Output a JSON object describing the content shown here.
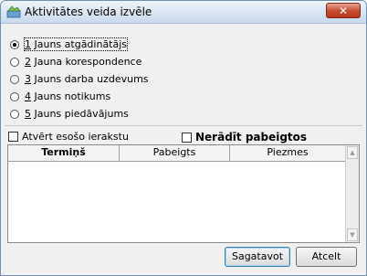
{
  "window": {
    "title": "Aktivitātes veida izvēle",
    "close_label": "✕"
  },
  "options": [
    {
      "number": "1",
      "label": " Jauns atgādinātājs",
      "checked": true
    },
    {
      "number": "2",
      "label": " Jauna korespondence",
      "checked": false
    },
    {
      "number": "3",
      "label": " Jauns darba uzdevums",
      "checked": false
    },
    {
      "number": "4",
      "label": " Jauns notikums",
      "checked": false
    },
    {
      "number": "5",
      "label": " Jauns piedāvājums",
      "checked": false
    }
  ],
  "checkboxes": {
    "open_existing": {
      "label": "Atvērt esošo ierakstu",
      "checked": false
    },
    "hide_completed": {
      "label": "Nerādīt pabeigtos",
      "checked": false
    }
  },
  "table": {
    "columns": [
      "Termiņš",
      "Pabeigts",
      "Piezmes"
    ],
    "rows": []
  },
  "buttons": {
    "confirm": "Sagatavot",
    "cancel": "Atcelt"
  },
  "colors": {
    "close_button": "#c94a2e",
    "titlebar": "#c9d9ec"
  }
}
